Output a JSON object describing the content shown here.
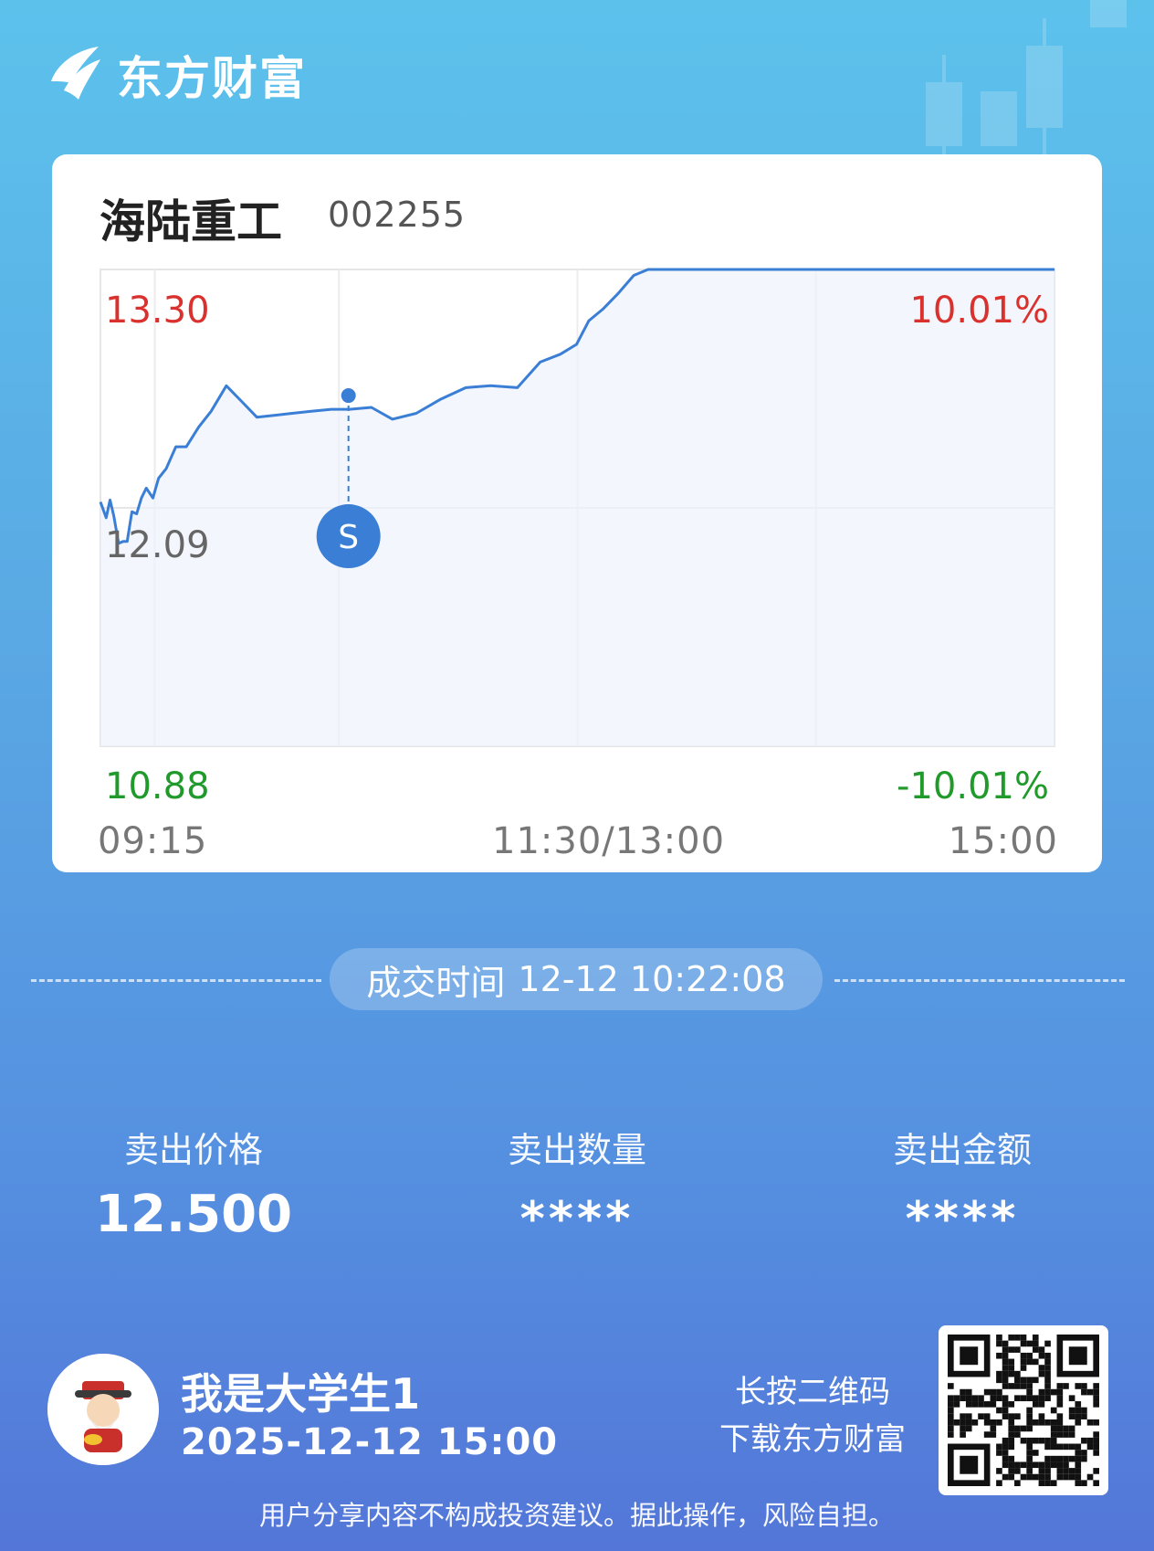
{
  "brand": {
    "name": "东方财富"
  },
  "stock": {
    "name": "海陆重工",
    "code": "002255"
  },
  "chart": {
    "price_high": "13.30",
    "price_prev_close": "12.09",
    "price_low": "10.88",
    "pct_high": "10.01%",
    "pct_low": "-10.01%",
    "time_start": "09:15",
    "time_mid": "11:30/13:00",
    "time_end": "15:00",
    "marker_label": "S",
    "line_color": "#3a7fd5",
    "up_color": "#d9322e",
    "down_color": "#1f9a2b"
  },
  "chart_data": {
    "type": "line",
    "ylim": [
      10.88,
      13.3
    ],
    "reference": 12.09,
    "x": [
      0,
      0.6,
      1,
      1.4,
      1.9,
      2.4,
      2.8,
      3.3,
      3.8,
      4.3,
      4.8,
      5.5,
      6.1,
      6.9,
      7.9,
      9.0,
      10.3,
      11.6,
      13.2,
      14.8,
      16.4,
      18.3,
      20.1,
      22.1,
      24.2,
      26.1,
      28.4,
      30.6,
      33.1,
      35.6,
      38.3,
      40.9,
      43.7,
      46.1,
      48.2,
      49.9,
      51.2,
      52.7,
      54.3,
      55.9,
      57.4,
      58.9,
      60.2,
      61.3,
      62.7,
      64.1,
      66,
      68.8,
      71.7,
      75,
      78.3,
      81.6,
      84.9,
      88.2,
      91.5,
      94.8,
      98.1,
      100
    ],
    "values": [
      12.12,
      12.04,
      12.13,
      12.05,
      11.91,
      11.92,
      11.92,
      12.07,
      12.06,
      12.14,
      12.19,
      12.14,
      12.24,
      12.29,
      12.4,
      12.4,
      12.5,
      12.58,
      12.71,
      12.63,
      12.55,
      12.56,
      12.57,
      12.58,
      12.59,
      12.59,
      12.6,
      12.54,
      12.57,
      12.64,
      12.7,
      12.71,
      12.7,
      12.83,
      12.87,
      12.92,
      13.04,
      13.1,
      13.18,
      13.27,
      13.3,
      13.3,
      13.3,
      13.3,
      13.3,
      13.3,
      13.3,
      13.3,
      13.3,
      13.3,
      13.3,
      13.3,
      13.3,
      13.3,
      13.3,
      13.3,
      13.3,
      13.3
    ],
    "marker": {
      "x": 26.0,
      "value": 12.66,
      "label": "S"
    }
  },
  "trade": {
    "time_label": "成交时间",
    "time_value": "12-12 10:22:08"
  },
  "stats": [
    {
      "label": "卖出价格",
      "value": "12.500"
    },
    {
      "label": "卖出数量",
      "value": "****"
    },
    {
      "label": "卖出金额",
      "value": "****"
    }
  ],
  "user": {
    "name": "我是大学生1",
    "time": "2025-12-12 15:00"
  },
  "qr": {
    "line1": "长按二维码",
    "line2": "下载东方财富"
  },
  "disclaimer": "用户分享内容不构成投资建议。据此操作，风险自担。"
}
